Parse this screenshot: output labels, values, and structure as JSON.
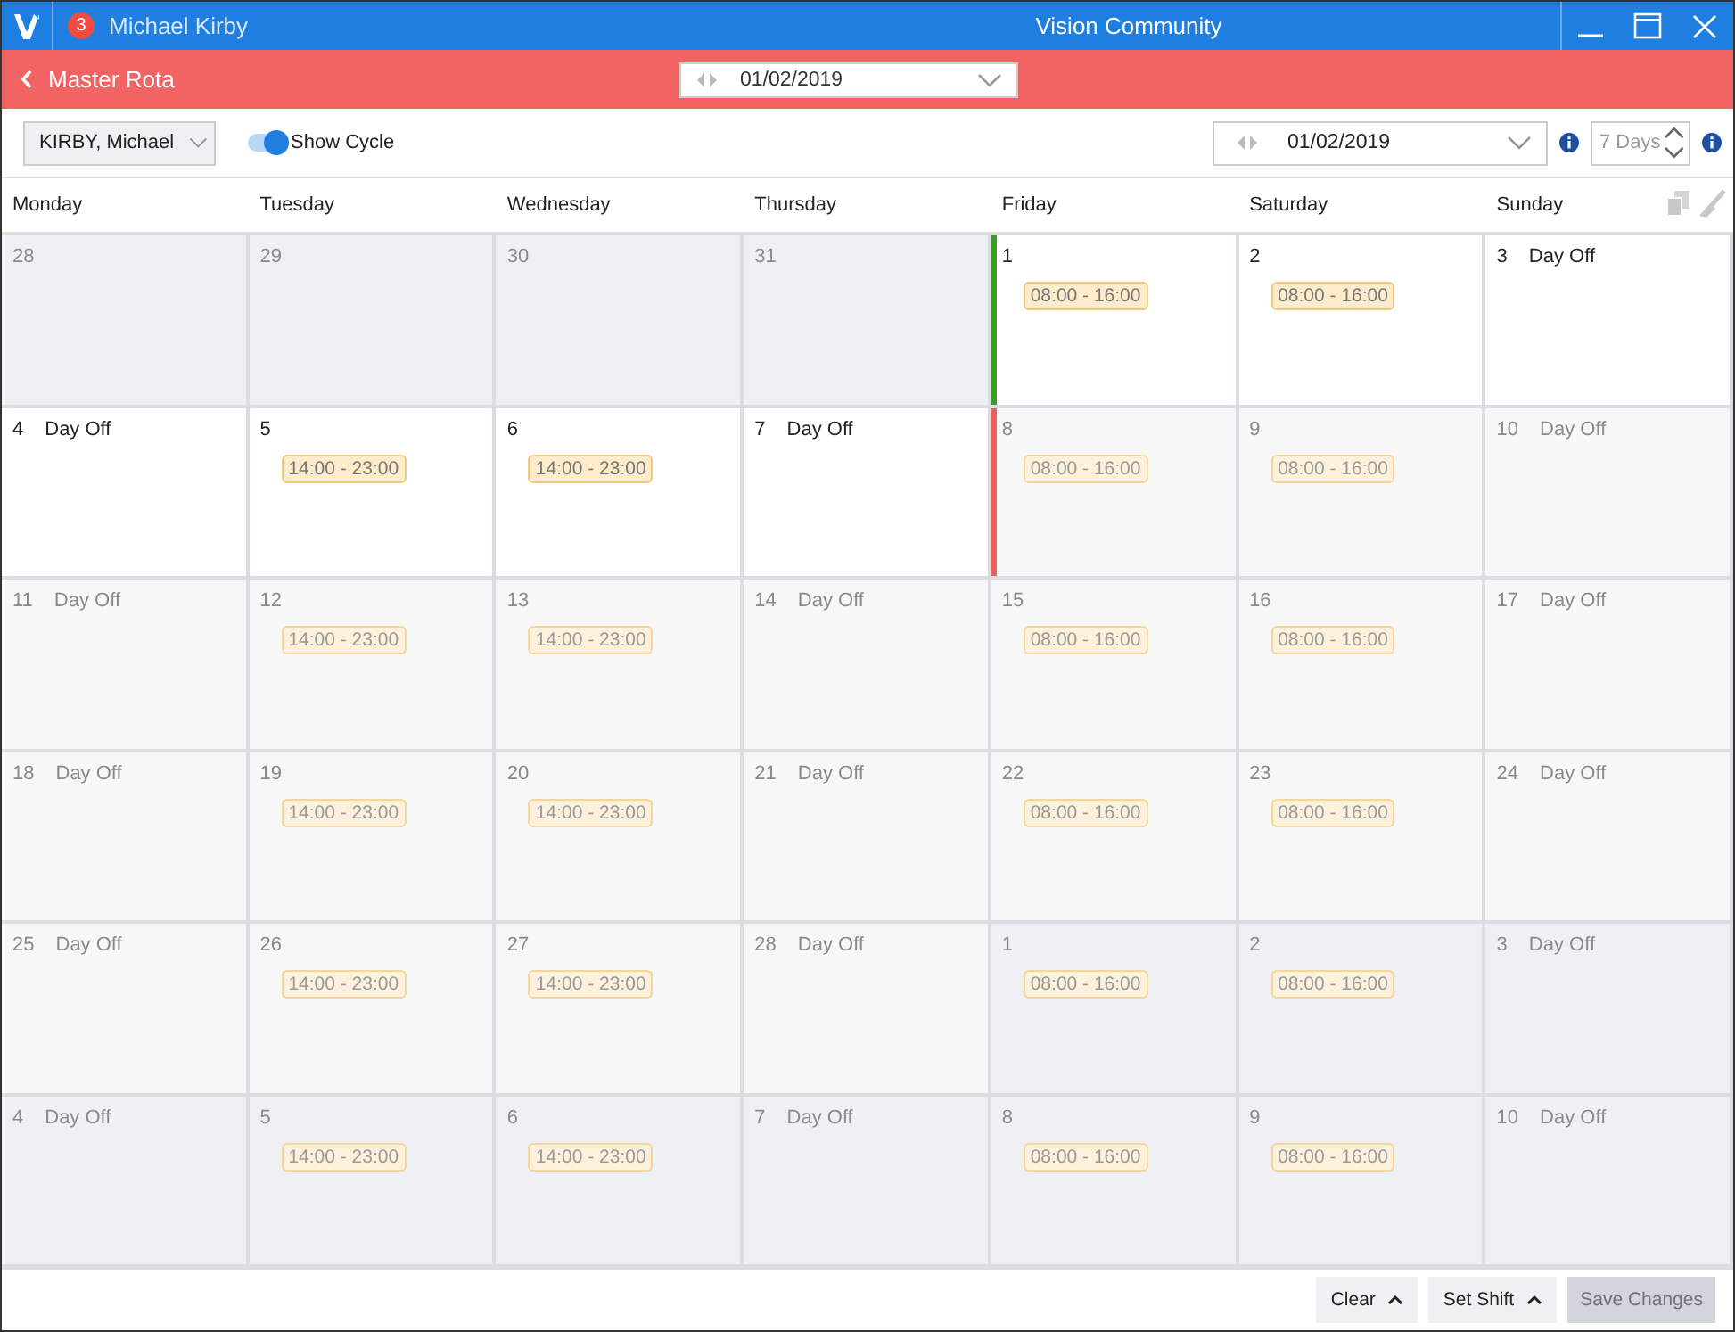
{
  "window": {
    "user": "Michael Kirby",
    "notification_count": "3",
    "title": "Vision Community"
  },
  "header": {
    "title": "Master Rota",
    "date": "01/02/2019"
  },
  "toolbar": {
    "staff": "KIRBY, Michael",
    "show_cycle": {
      "label": "Show Cycle",
      "on": true
    },
    "date": "01/02/2019",
    "days": "7 Days"
  },
  "weekdays": [
    "Monday",
    "Tuesday",
    "Wednesday",
    "Thursday",
    "Friday",
    "Saturday",
    "Sunday"
  ],
  "cells": [
    {
      "day": "28",
      "kind": "outside"
    },
    {
      "day": "29",
      "kind": "outside"
    },
    {
      "day": "30",
      "kind": "outside"
    },
    {
      "day": "31",
      "kind": "outside"
    },
    {
      "day": "1",
      "kind": "current",
      "shift": "08:00 - 16:00",
      "color": "#3a9a2a"
    },
    {
      "day": "2",
      "kind": "current",
      "shift": "08:00 - 16:00"
    },
    {
      "day": "3",
      "kind": "current",
      "label": "Day Off"
    },
    {
      "day": "4",
      "kind": "current",
      "label": "Day Off"
    },
    {
      "day": "5",
      "kind": "current",
      "shift": "14:00 - 23:00"
    },
    {
      "day": "6",
      "kind": "current",
      "shift": "14:00 - 23:00"
    },
    {
      "day": "7",
      "kind": "current",
      "label": "Day Off"
    },
    {
      "day": "8",
      "kind": "cycle",
      "shift": "08:00 - 16:00",
      "color": "#ef5f5f"
    },
    {
      "day": "9",
      "kind": "cycle",
      "shift": "08:00 - 16:00"
    },
    {
      "day": "10",
      "kind": "cycle",
      "label": "Day Off"
    },
    {
      "day": "11",
      "kind": "cycle",
      "label": "Day Off"
    },
    {
      "day": "12",
      "kind": "cycle",
      "shift": "14:00 - 23:00"
    },
    {
      "day": "13",
      "kind": "cycle",
      "shift": "14:00 - 23:00"
    },
    {
      "day": "14",
      "kind": "cycle",
      "label": "Day Off"
    },
    {
      "day": "15",
      "kind": "cycle",
      "shift": "08:00 - 16:00"
    },
    {
      "day": "16",
      "kind": "cycle",
      "shift": "08:00 - 16:00"
    },
    {
      "day": "17",
      "kind": "cycle",
      "label": "Day Off"
    },
    {
      "day": "18",
      "kind": "cycle",
      "label": "Day Off"
    },
    {
      "day": "19",
      "kind": "cycle",
      "shift": "14:00 - 23:00"
    },
    {
      "day": "20",
      "kind": "cycle",
      "shift": "14:00 - 23:00"
    },
    {
      "day": "21",
      "kind": "cycle",
      "label": "Day Off"
    },
    {
      "day": "22",
      "kind": "cycle",
      "shift": "08:00 - 16:00"
    },
    {
      "day": "23",
      "kind": "cycle",
      "shift": "08:00 - 16:00"
    },
    {
      "day": "24",
      "kind": "cycle",
      "label": "Day Off"
    },
    {
      "day": "25",
      "kind": "cycle",
      "label": "Day Off"
    },
    {
      "day": "26",
      "kind": "cycle",
      "shift": "14:00 - 23:00"
    },
    {
      "day": "27",
      "kind": "cycle",
      "shift": "14:00 - 23:00"
    },
    {
      "day": "28",
      "kind": "cycle",
      "label": "Day Off"
    },
    {
      "day": "1",
      "kind": "outside",
      "shift": "08:00 - 16:00"
    },
    {
      "day": "2",
      "kind": "outside",
      "shift": "08:00 - 16:00"
    },
    {
      "day": "3",
      "kind": "outside",
      "label": "Day Off"
    },
    {
      "day": "4",
      "kind": "outside",
      "label": "Day Off"
    },
    {
      "day": "5",
      "kind": "outside",
      "shift": "14:00 - 23:00"
    },
    {
      "day": "6",
      "kind": "outside",
      "shift": "14:00 - 23:00"
    },
    {
      "day": "7",
      "kind": "outside",
      "label": "Day Off"
    },
    {
      "day": "8",
      "kind": "outside",
      "shift": "08:00 - 16:00"
    },
    {
      "day": "9",
      "kind": "outside",
      "shift": "08:00 - 16:00"
    },
    {
      "day": "10",
      "kind": "outside",
      "label": "Day Off"
    }
  ],
  "footer": {
    "buttons": [
      {
        "label": "Clear",
        "kind": "menu",
        "disabled": false
      },
      {
        "label": "Set Shift",
        "kind": "menu",
        "disabled": false
      },
      {
        "label": "Save Changes",
        "kind": "plain",
        "disabled": true
      }
    ]
  }
}
